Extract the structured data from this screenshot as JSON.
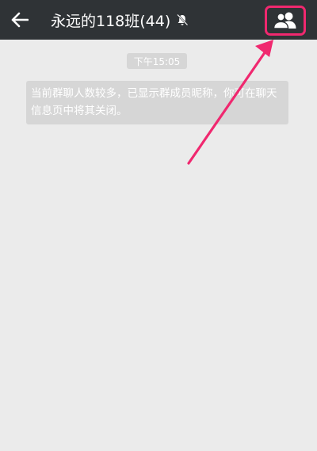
{
  "header": {
    "title": "永远的118班(44)",
    "back_icon": "arrow-left-icon",
    "mute_icon": "bell-mute-icon",
    "members_icon": "group-members-icon"
  },
  "chat": {
    "timestamp": "下午15:05",
    "system_notice": "当前群聊人数较多，已显示群成员昵称，你可在聊天信息页中将其关闭。"
  },
  "colors": {
    "header_bg": "#2f3336",
    "chat_bg": "#ebebeb",
    "highlight": "#f0286f"
  }
}
